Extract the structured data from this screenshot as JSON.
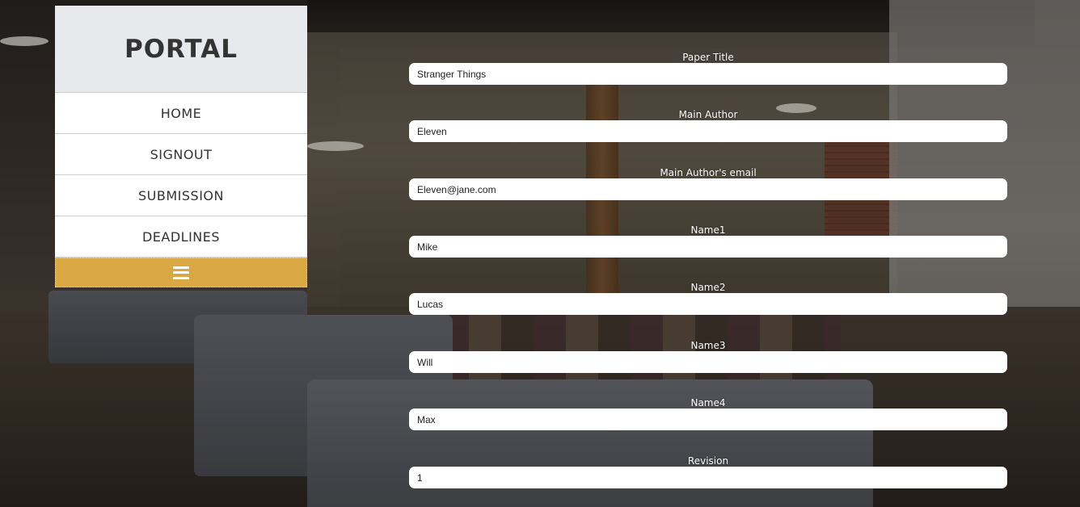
{
  "sidebar": {
    "brand": "PORTAL",
    "items": [
      {
        "label": "HOME"
      },
      {
        "label": "SIGNOUT"
      },
      {
        "label": "SUBMISSION"
      },
      {
        "label": "DEADLINES"
      }
    ],
    "toggle_icon": "hamburger-icon",
    "toggle_color": "#d9a842"
  },
  "form": {
    "fields": [
      {
        "label": "Paper Title",
        "value": "Stranger Things"
      },
      {
        "label": "Main Author",
        "value": "Eleven"
      },
      {
        "label": "Main Author's email",
        "value": "Eleven@jane.com"
      },
      {
        "label": "Name1",
        "value": "Mike"
      },
      {
        "label": "Name2",
        "value": "Lucas"
      },
      {
        "label": "Name3",
        "value": "Will"
      },
      {
        "label": "Name4",
        "value": "Max"
      },
      {
        "label": "Revision",
        "value": "1"
      }
    ]
  }
}
